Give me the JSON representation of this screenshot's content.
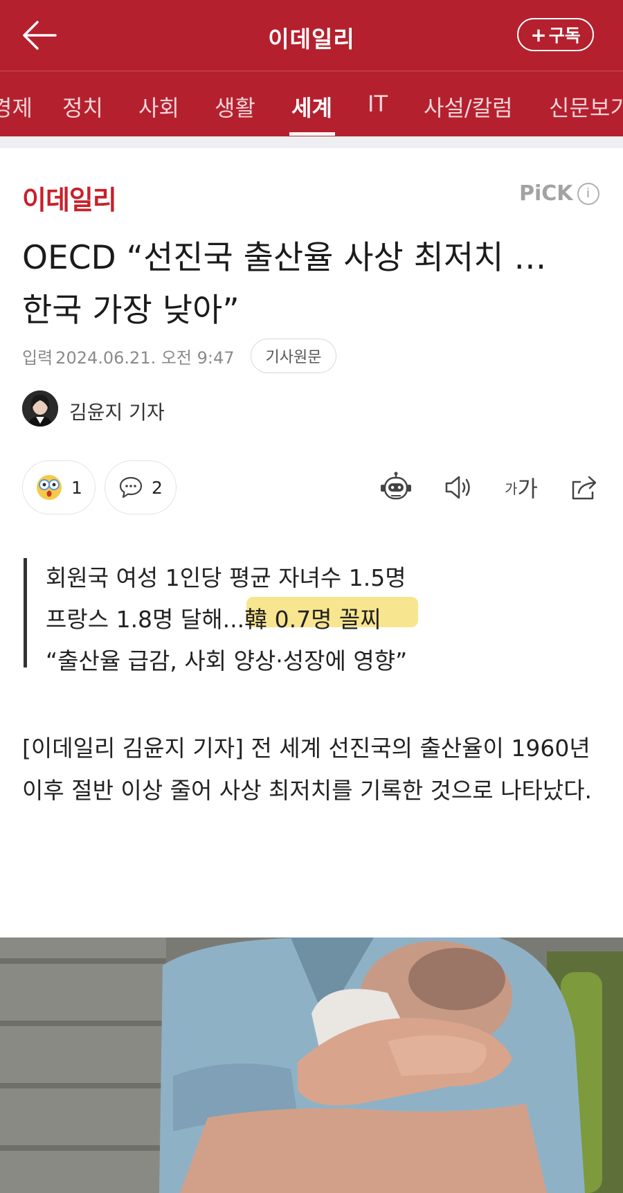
{
  "header": {
    "app_title": "이데일리",
    "subscribe_label": "구독",
    "subscribe_plus": "+",
    "back_icon": "arrow-left-icon"
  },
  "nav": {
    "items": [
      {
        "label": "경제"
      },
      {
        "label": "정치"
      },
      {
        "label": "사회"
      },
      {
        "label": "생활"
      },
      {
        "label": "세계",
        "active": true
      },
      {
        "label": "IT"
      },
      {
        "label": "사설/칼럼"
      },
      {
        "label": "신문보기"
      }
    ]
  },
  "article": {
    "brand": "이데일리",
    "pick_label": "PiCK",
    "pick_info": "i",
    "headline_line1": "OECD “선진국 출산율 사상 최저치 …",
    "headline_line2": "한국 가장 낮아”",
    "date_prefix": "입력",
    "date_value": "2024.06.21. 오전 9:47",
    "origin_label": "기사원문",
    "reporter": "김윤지 기자"
  },
  "actions": {
    "reaction_count": "1",
    "comment_count": "2",
    "font_small": "가",
    "font_large": "가"
  },
  "summary": {
    "line1": "회원국 여성 1인당 평균 자녀수 1.5명",
    "line2_prefix": "프랑스 1.8명 달해...",
    "line2_highlight": "韓 0.7명 꼴찌",
    "line3": "“출산율 급감, 사회 양상·성장에 영향”"
  },
  "body": {
    "paragraph": "[이데일리 김윤지 기자] 전 세계 선진국의 출산율이 1960년 이후 절반 이상 줄어 사상 최저치를 기록한 것으로 나타났다."
  },
  "colors": {
    "brand_red": "#b5202e",
    "highlight": "#f7e07b"
  }
}
